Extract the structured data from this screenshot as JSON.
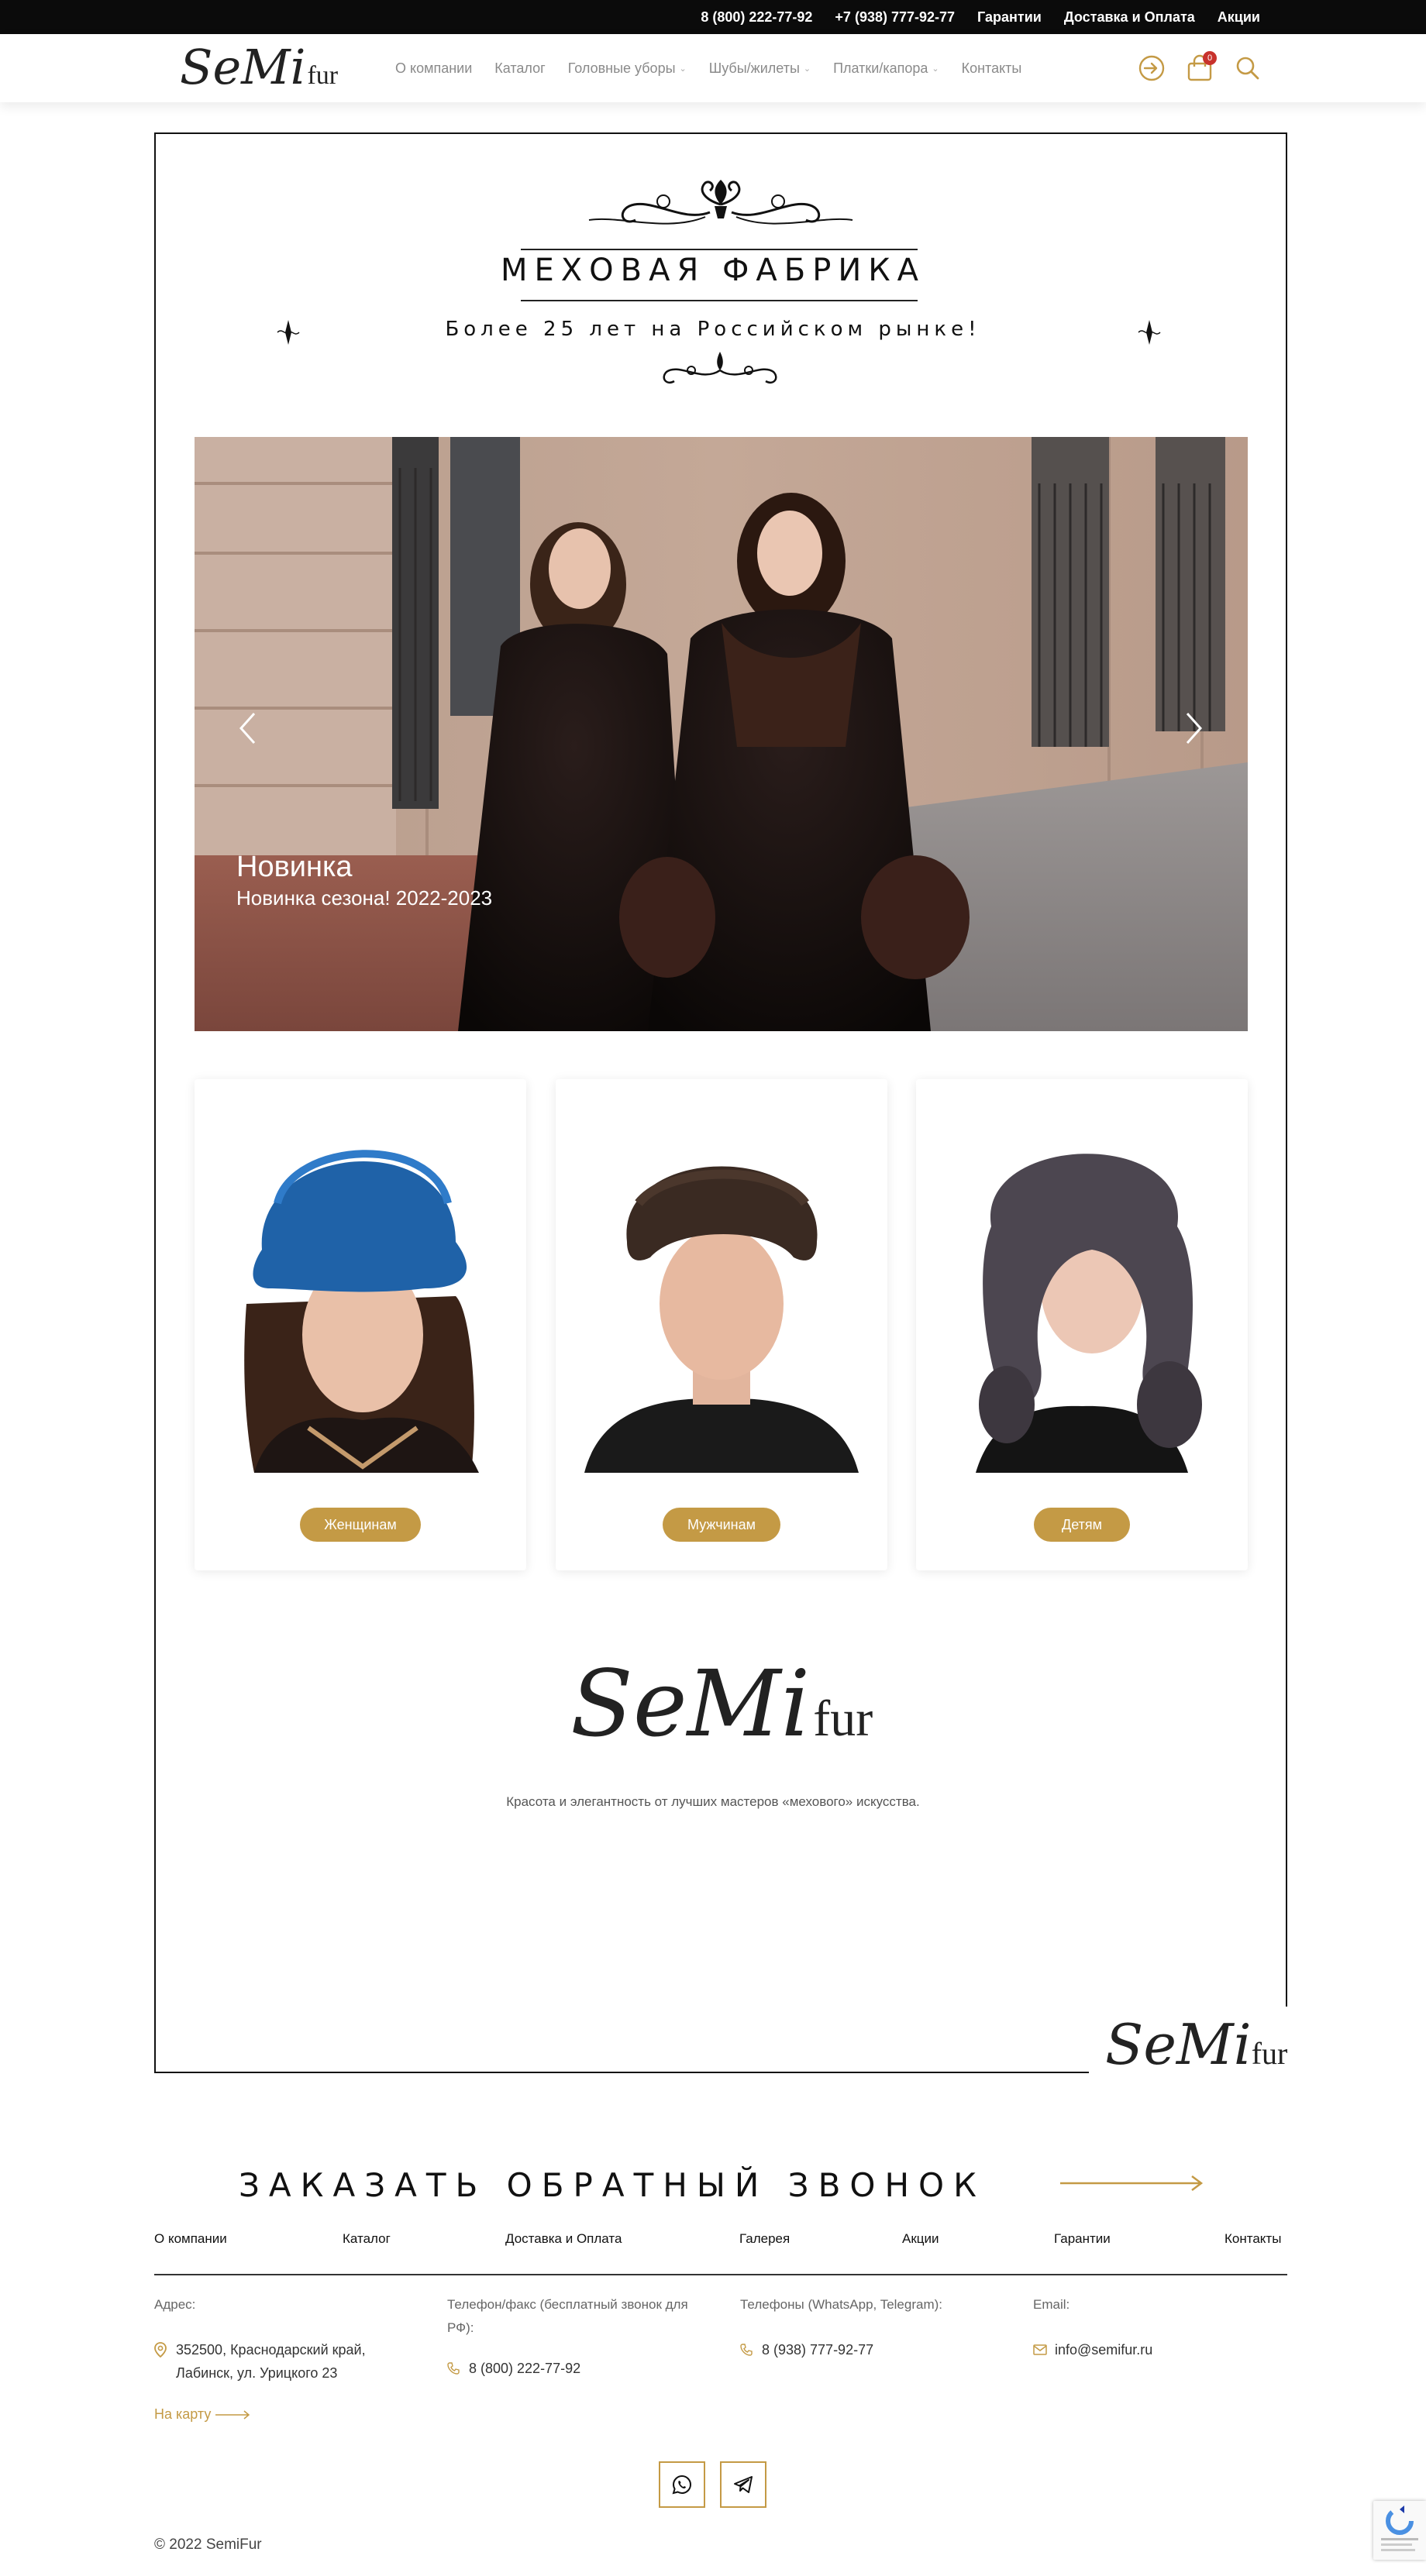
{
  "topbar": {
    "phone_free": "8 (800) 222-77-92",
    "phone_mobile": "+7 (938) 777-92-77",
    "guarantees": "Гарантии",
    "delivery": "Доставка и Оплата",
    "promo": "Акции"
  },
  "header": {
    "logo_script": "SeMi",
    "logo_fur": "fur",
    "nav": [
      {
        "label": "О компании",
        "dropdown": false
      },
      {
        "label": "Каталог",
        "dropdown": false
      },
      {
        "label": "Головные уборы",
        "dropdown": true
      },
      {
        "label": "Шубы/жилеты",
        "dropdown": true
      },
      {
        "label": "Платки/капора",
        "dropdown": true
      },
      {
        "label": "Контакты",
        "dropdown": false
      }
    ],
    "icons": [
      "login-icon",
      "cart-icon",
      "search-icon"
    ],
    "cart_count": "0"
  },
  "hero": {
    "title": "МЕХОВАЯ ФАБРИКА",
    "subtitle": "Более 25 лет на Российском рынке!"
  },
  "slider": {
    "title": "Новинка",
    "subtitle": "Новинка сезона! 2022-2023"
  },
  "cards": [
    {
      "button": "Женщинам"
    },
    {
      "button": "Мужчинам"
    },
    {
      "button": "Детям"
    }
  ],
  "brand": {
    "logo_script": "SeMi",
    "logo_fur": "fur",
    "tagline": "Красота и элегантность от лучших мастеров «мехового» искусства."
  },
  "callback": {
    "label": "ЗАКАЗАТЬ ОБРАТНЫЙ ЗВОНОК"
  },
  "footer": {
    "nav": [
      "О компании",
      "Каталог",
      "Доставка и Оплата",
      "Галерея",
      "Акции",
      "Гарантии",
      "Контакты"
    ],
    "address_label": "Адрес:",
    "address_line1": "352500, Краснодарский край,",
    "address_line2": "Лабинск, ул. Урицкого 23",
    "map_link": "На карту",
    "phone_label_1": "Телефон/факс (бесплатный звонок для",
    "phone_label_2": "РФ):",
    "phone_value": "8 (800) 222-77-92",
    "messenger_label": "Телефоны (WhatsApp, Telegram):",
    "messenger_value": "8 (938) 777-92-77",
    "email_label": "Email:",
    "email_value": "info@semifur.ru",
    "social": [
      "whatsapp-icon",
      "telegram-icon"
    ],
    "copyright": "© 2022 SemiFur"
  },
  "colors": {
    "accent": "#c49a45",
    "topbar": "#0b0b0b",
    "badge": "#c8322c"
  }
}
